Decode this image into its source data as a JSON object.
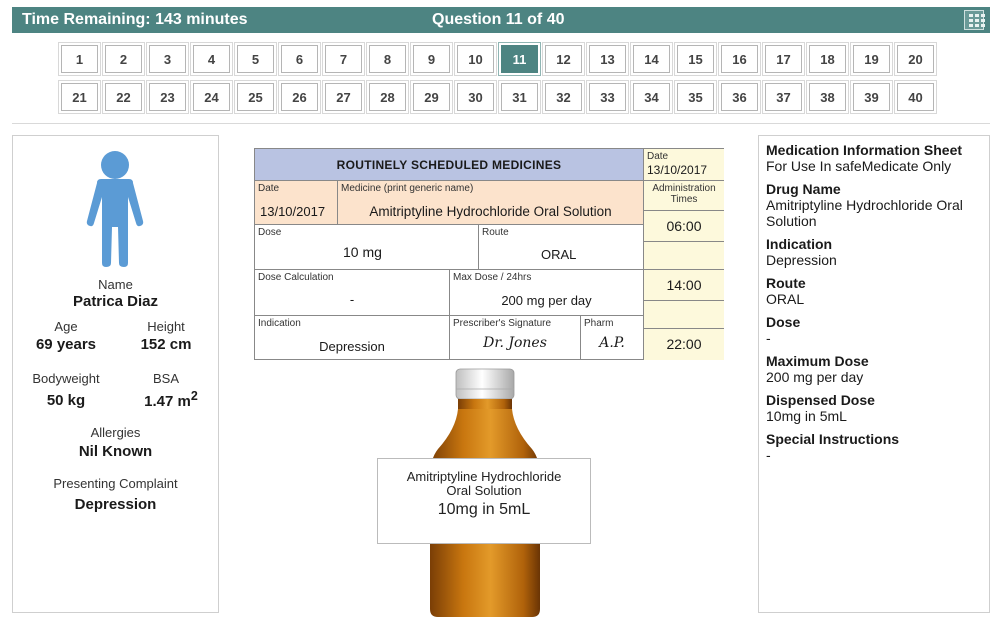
{
  "header": {
    "time_remaining": "Time Remaining: 143 minutes",
    "question_label": "Question 11 of 40",
    "calculator_icon": "calculator-icon",
    "bar_color": "#4d8482"
  },
  "questions": {
    "row1": [
      "1",
      "2",
      "3",
      "4",
      "5",
      "6",
      "7",
      "8",
      "9",
      "10",
      "11",
      "12",
      "13",
      "14",
      "15",
      "16",
      "17",
      "18",
      "19",
      "20"
    ],
    "row2": [
      "21",
      "22",
      "23",
      "24",
      "25",
      "26",
      "27",
      "28",
      "29",
      "30",
      "31",
      "32",
      "33",
      "34",
      "35",
      "36",
      "37",
      "38",
      "39",
      "40"
    ],
    "current": "11"
  },
  "patient": {
    "icon": "person-icon",
    "name_label": "Name",
    "name": "Patrica Diaz",
    "age_label": "Age",
    "age": "69 years",
    "height_label": "Height",
    "height": "152 cm",
    "bodyweight_label": "Bodyweight",
    "bodyweight": "50 kg",
    "bsa_label": "BSA",
    "bsa": "1.47 m",
    "bsa_sup": "2",
    "allergies_label": "Allergies",
    "allergies": "Nil Known",
    "complaint_label": "Presenting Complaint",
    "complaint": "Depression"
  },
  "chart": {
    "header": "ROUTINELY SCHEDULED MEDICINES",
    "date_label": "Date",
    "date": "13/10/2017",
    "admin_date_label": "Date",
    "admin_date": "13/10/2017",
    "medicine_label": "Medicine (print generic name)",
    "medicine": "Amitriptyline Hydrochloride Oral Solution",
    "admin_times_label": "Administration Times",
    "dose_label": "Dose",
    "dose": "10 mg",
    "route_label": "Route",
    "route": "ORAL",
    "dose_calc_label": "Dose Calculation",
    "dose_calc": "-",
    "max_dose_label": "Max Dose / 24hrs",
    "max_dose": "200 mg per day",
    "indication_label": "Indication",
    "indication": "Depression",
    "prescriber_label": "Prescriber's Signature",
    "prescriber": "Dr. Jones",
    "pharm_label": "Pharm",
    "pharm": "A.P.",
    "times": [
      "06:00",
      "14:00",
      "22:00"
    ]
  },
  "bottle": {
    "label_line1": "Amitriptyline Hydrochloride",
    "label_line2": "Oral Solution",
    "label_strength": "10mg in 5mL"
  },
  "info_sheet": {
    "title": "Medication Information Sheet",
    "subtitle": "For Use In safeMedicate Only",
    "drug_name_label": "Drug Name",
    "drug_name": "Amitriptyline Hydrochloride Oral Solution",
    "indication_label": "Indication",
    "indication": "Depression",
    "route_label": "Route",
    "route": "ORAL",
    "dose_label": "Dose",
    "dose": "-",
    "max_dose_label": "Maximum Dose",
    "max_dose": "200 mg per day",
    "dispensed_label": "Dispensed Dose",
    "dispensed": "10mg in 5mL",
    "special_label": "Special Instructions",
    "special": "-"
  }
}
